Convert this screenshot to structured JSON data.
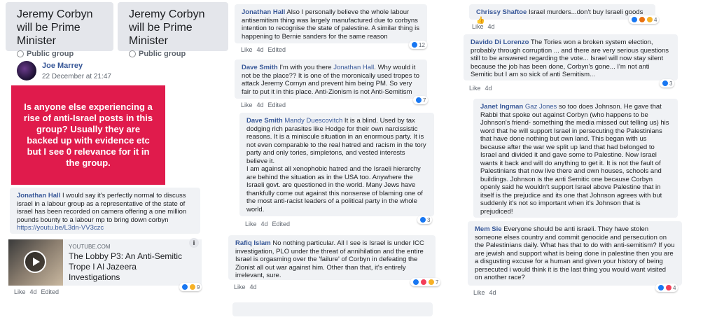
{
  "groups": [
    {
      "title": "Jeremy Corbyn will be Prime Minister",
      "privacy": "Public group"
    },
    {
      "title": "Jeremy Corbyn will be Prime Minister",
      "privacy": "Public group"
    }
  ],
  "post": {
    "author": "Joe Marrey",
    "date": "22 December at 21:47",
    "text": "Is anyone else experiencing a rise of anti-Israel posts in this group? Usually they are backed up with evidence etc but I see 0 relevance for it in the group."
  },
  "comments_left": [
    {
      "name": "Jonathan Hall",
      "text": "I would say it's perfectly normal to discuss israel in a labour group as a representative of the state of israel has been recorded on camera offering a one million pounds bounty to a labour mp to bring down corbyn",
      "link": "https://youtu.be/L3dn-VV3czc",
      "like": "Like",
      "time": "4d",
      "edited": "Edited",
      "react_count": "9"
    }
  ],
  "link_preview": {
    "domain": "YOUTUBE.COM",
    "title": "The Lobby P3: An Anti-Semitic Trope I Al Jazeera Investigations",
    "info": "i"
  },
  "comments_mid": [
    {
      "name": "Jonathan Hall",
      "text": "Also I personally believe the whole labour antisemitism thing was largely manufactured due to corbyns intention to recognise the state of palestine. A similar thing is happening to Bernie sanders for the same reason",
      "like": "Like",
      "time": "4d",
      "edited": "Edited",
      "react_count": "12"
    },
    {
      "name": "Dave Smith",
      "pre": "I'm with you there ",
      "tag": "Jonathan Hall",
      "text": ". Why would it not be the place?? It is one of the moronically used tropes to attack Jeremy Cornyn and prevent him being PM. So very fair to put it in this place. Anti-Zionism is not Anti-Semitism",
      "like": "Like",
      "time": "4d",
      "edited": "Edited",
      "react_count": "7"
    },
    {
      "name": "Dave Smith",
      "tag": "Mandy Duescovitch",
      "text": " It is a blind. Used by tax dodging rich parasites like Hodge for their own narcissistic reasons. It is a miniscule situation in an enormous party. It is not even comparable to the real hatred and racism in the tory party and only tories, simpletons, and vested interests believe it.",
      "text2": "I am against all xenophobic hatred and the Israeli hierarchy are behind the situation as in the USA too. Anywhere the Israeli govt. are questioned in the world. Many Jews have thankfully come out against this nonsense of blaming one of the most anti-racist leaders of a political party in the whole world.",
      "like": "Like",
      "time": "4d",
      "edited": "Edited",
      "react_count": "3"
    },
    {
      "name": "Rafiq Islam",
      "text": "No nothing particular. All I see is Israel is under ICC investigation, PLO under the threat of annihilation and the entire Israel is orgasming over the 'failure' of Corbyn in defeating the Zionist all out war against him. Other than that, it's entirely irrelevant, sure.",
      "like": "Like",
      "time": "4d",
      "react_count": "7"
    }
  ],
  "comments_right": [
    {
      "name": "Chrissy Shaftoe",
      "text": "Israel murders...don't buy Israeli goods",
      "emoji": "👍",
      "like": "Like",
      "time": "4d",
      "react_count": "4"
    },
    {
      "name": "Davido Di Lorenzo",
      "text": "The Tories won a broken system election, probably through corruption ... and there are very serious questions still to be answered regarding the vote... Israel will now stay silent because the job has been done, Corbyn's gone... I'm not anti Semitic but I am so sick of anti Semitism...",
      "like": "Like",
      "time": "4d",
      "react_count": "3"
    },
    {
      "name": "Janet Ingman",
      "tag": "Gaz Jones",
      "text": " so too does Johnson. He gave that Rabbi that spoke out against Corbyn (who happens to be Johnson's friend- something the media missed out telling us) his word that he will support Israel in persecuting the Palestinians that have done nothing but own land. This began with us because after the war we split up land that had belonged to Israel and divided it and gave some to Palestine. Now Israel wants it back and will do anything to get it. It is not the fault of Palestinians that now live there and own houses, schools and buildings. Johnson is the anti Semitic one because Corbyn openly said he wouldn't support Israel above Palestine that in itself is the prejudice and its one that Johnson agrees with but suddenly it's not so important when it's Johnson that is prejudiced!",
      "like": "Like",
      "time": "4d"
    },
    {
      "name": "Mem Sie",
      "text": "Everyone should be anti israeli. They have stolen someone elses country and commit genocide and persecution on the Palestinians daily. What has that to do with anti-semitism? If you are jewish and support what is being done in palestine then you are a disgusting excuse for a human and given your history of being persecuted i would think it is the last thing you would want visited on another race?",
      "like": "Like",
      "time": "4d",
      "react_count": "4"
    }
  ]
}
